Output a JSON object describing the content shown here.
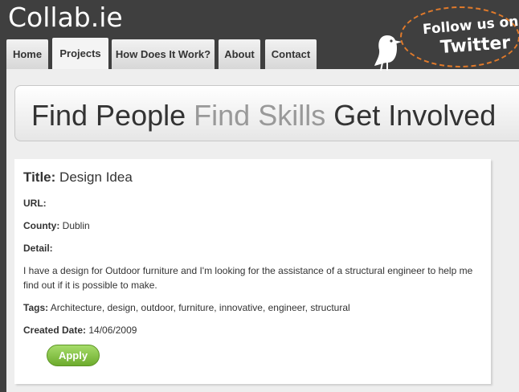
{
  "site": {
    "logo": "Collab.ie"
  },
  "nav": {
    "tabs": [
      "Home",
      "Projects",
      "How Does It Work?",
      "About",
      "Contact"
    ],
    "active": "Projects"
  },
  "twitter": {
    "line1": "Follow us on",
    "line2": "Twitter",
    "accent": "#e07a2b"
  },
  "banner": {
    "part1": "Find People",
    "part2": "Find Skills",
    "part3": "Get Involved"
  },
  "project": {
    "title_label": "Title:",
    "title": "Design Idea",
    "url_label": "URL:",
    "url": "",
    "county_label": "County:",
    "county": "Dublin",
    "detail_label": "Detail:",
    "detail": "I have a design for Outdoor furniture and I'm looking for the assistance of a structural engineer to help me find out if it is possible to make.",
    "tags_label": "Tags:",
    "tags": "Architecture, design, outdoor, furniture, innovative, engineer, structural",
    "created_label": "Created Date:",
    "created": "14/06/2009",
    "apply_label": "Apply"
  },
  "colors": {
    "header_bg": "#3f3f3f",
    "apply_green": "#6dab2d"
  }
}
